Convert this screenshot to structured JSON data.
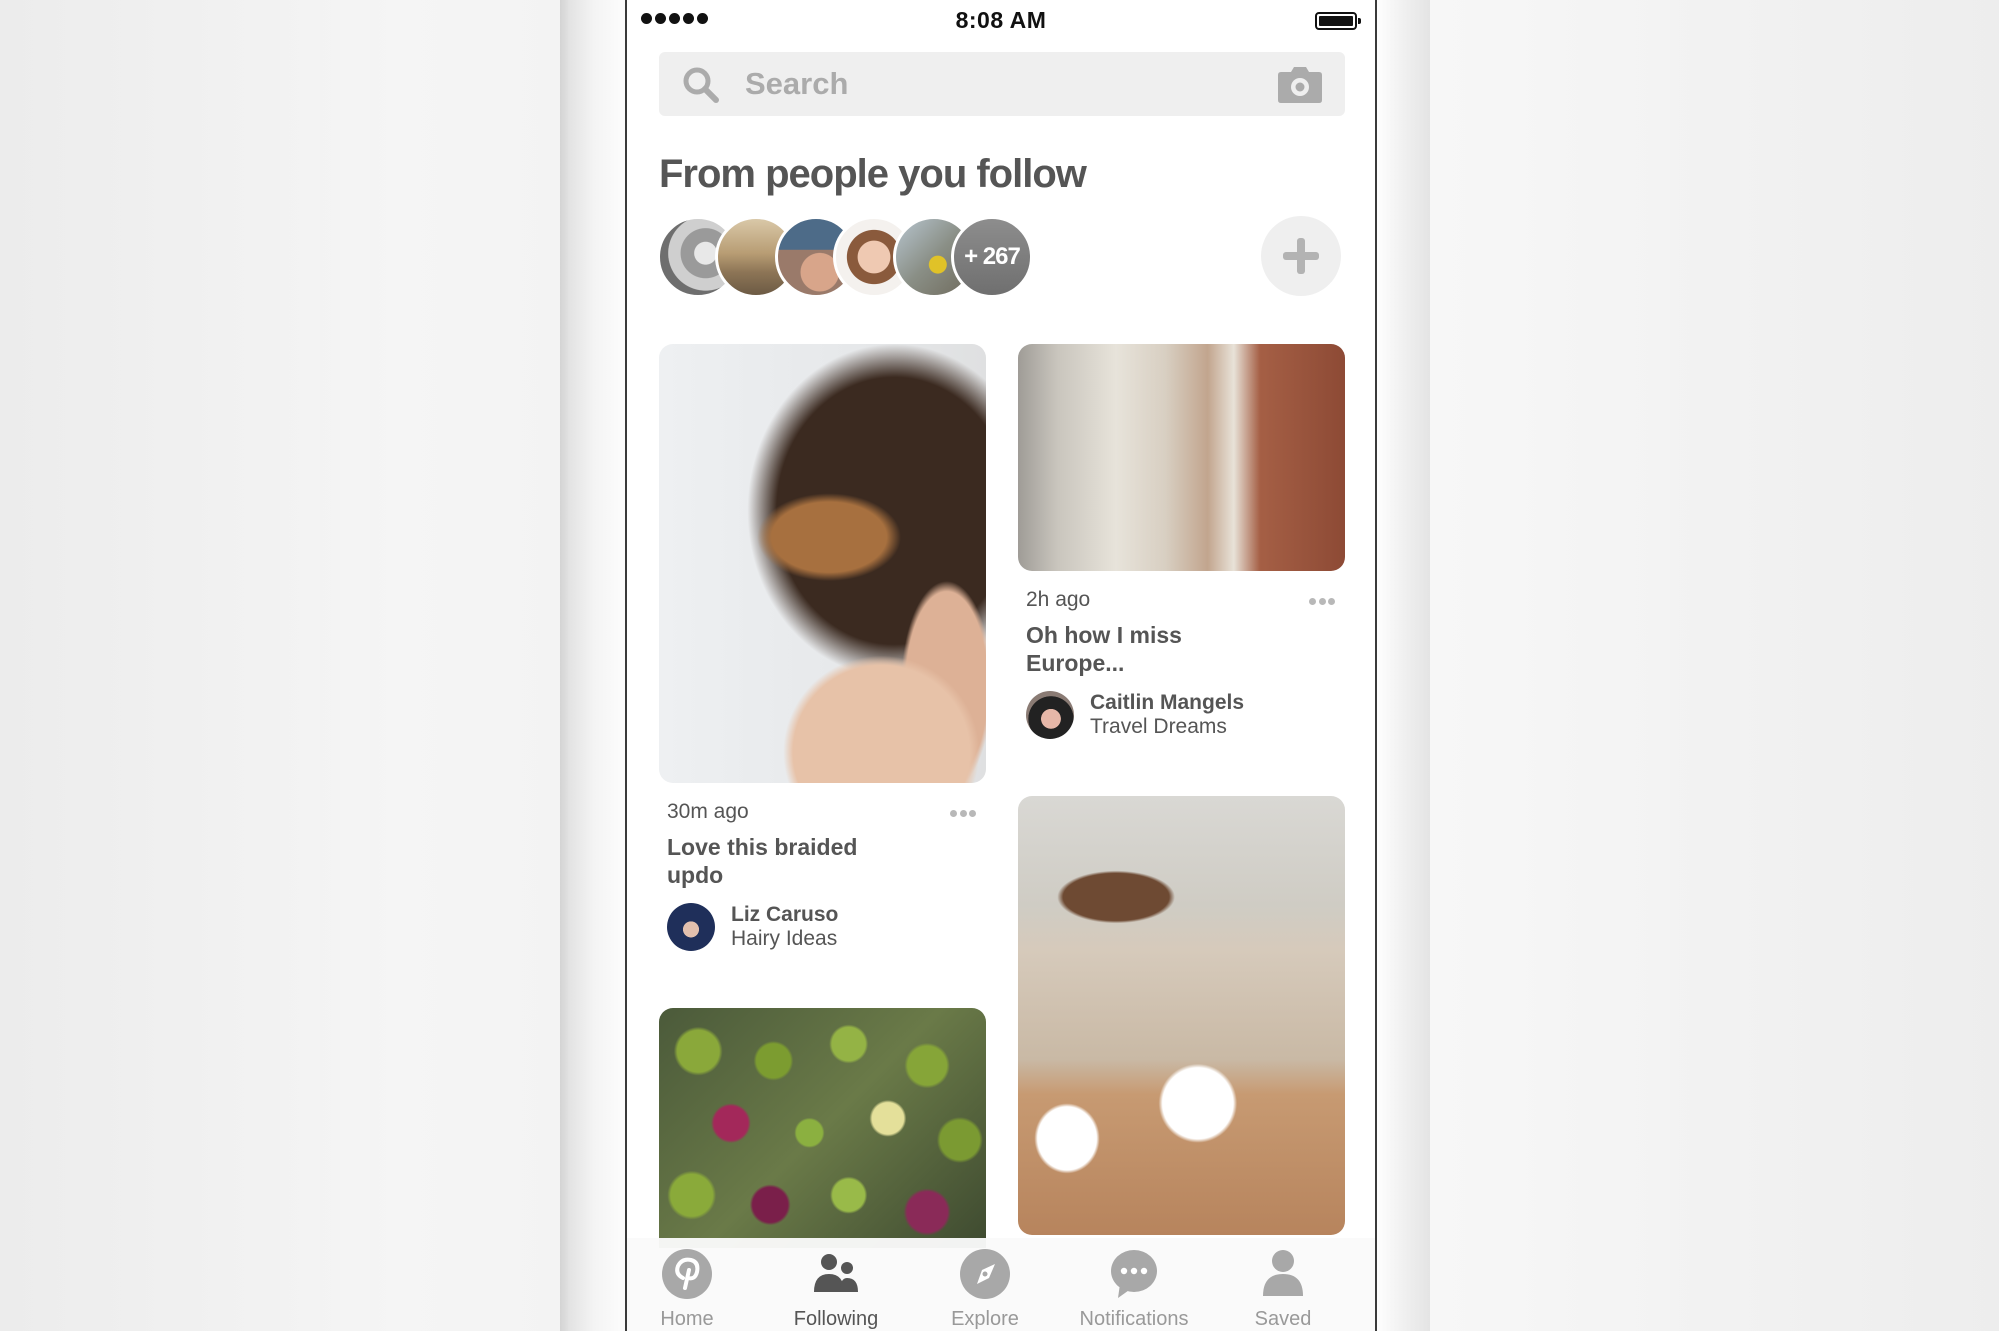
{
  "status_bar": {
    "signal_dots": 5,
    "time": "8:08 AM",
    "battery_level": 1.0
  },
  "search": {
    "placeholder": "Search",
    "value": "",
    "search_icon": "search-icon",
    "camera_icon": "camera-icon"
  },
  "following": {
    "title": "From people you follow",
    "avatars": [
      {
        "name": "followed-user-1"
      },
      {
        "name": "followed-user-2"
      },
      {
        "name": "followed-user-3"
      },
      {
        "name": "followed-user-4"
      },
      {
        "name": "followed-user-5"
      }
    ],
    "more_count_label": "+ 267",
    "add_icon": "plus-icon"
  },
  "pins": [
    {
      "image": "braided-hair-photo",
      "time": "30m ago",
      "title_line1": "Love this braided",
      "title_line2": "updo",
      "author": "Liz Caruso",
      "board": "Hairy Ideas",
      "more_icon": "more-dots-icon"
    },
    {
      "image": "european-street-photo",
      "time": "2h ago",
      "title_line1": "Oh how I miss",
      "title_line2": "Europe...",
      "author": "Caitlin Mangels",
      "board": "Travel Dreams",
      "more_icon": "more-dots-icon"
    },
    {
      "image": "brussels-sprouts-skewers-photo"
    },
    {
      "image": "dining-room-interior-photo"
    }
  ],
  "tabbar": {
    "active": "Following",
    "tabs": [
      {
        "label": "Home",
        "icon": "pinterest-logo-icon"
      },
      {
        "label": "Following",
        "icon": "people-icon"
      },
      {
        "label": "Explore",
        "icon": "compass-icon"
      },
      {
        "label": "Notifications",
        "icon": "speech-bubble-icon"
      },
      {
        "label": "Saved",
        "icon": "person-icon"
      }
    ]
  }
}
